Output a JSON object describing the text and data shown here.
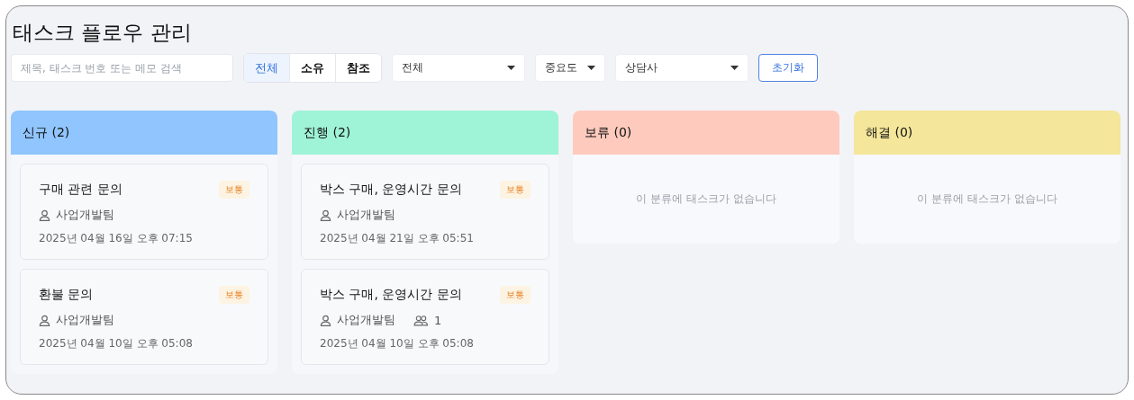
{
  "title": "태스크 플로우 관리",
  "search": {
    "placeholder": "제목, 태스크 번호 또는 메모 검색"
  },
  "scope_tabs": [
    {
      "label": "전체",
      "selected": true
    },
    {
      "label": "소유",
      "selected": false
    },
    {
      "label": "참조",
      "selected": false
    }
  ],
  "filters": [
    {
      "value": "전체"
    },
    {
      "value": "중요도"
    },
    {
      "value": "상담사"
    }
  ],
  "reset_button": "초기화",
  "columns": [
    {
      "title": "신규 (2)",
      "color": "#90c5fd",
      "cards": [
        {
          "title": "구매 관련 문의",
          "priority": "보통",
          "team": "사업개발팀",
          "date": "2025년 04월 16일 오후 07:15"
        },
        {
          "title": "환불 문의",
          "priority": "보통",
          "team": "사업개발팀",
          "date": "2025년 04월 10일 오후 05:08"
        }
      ]
    },
    {
      "title": "진행 (2)",
      "color": "#9ff3d6",
      "cards": [
        {
          "title": "박스 구매, 운영시간 문의",
          "priority": "보통",
          "team": "사업개발팀",
          "date": "2025년 04월 21일 오후 05:51"
        },
        {
          "title": "박스 구매, 운영시간 문의",
          "priority": "보통",
          "team": "사업개발팀",
          "members": "1",
          "date": "2025년 04월 10일 오후 05:08"
        }
      ]
    },
    {
      "title": "보류 (0)",
      "color": "#fdcabd",
      "empty": "이 분류에 태스크가 없습니다"
    },
    {
      "title": "해결 (0)",
      "color": "#f4e69a",
      "empty": "이 분류에 태스크가 없습니다"
    }
  ]
}
